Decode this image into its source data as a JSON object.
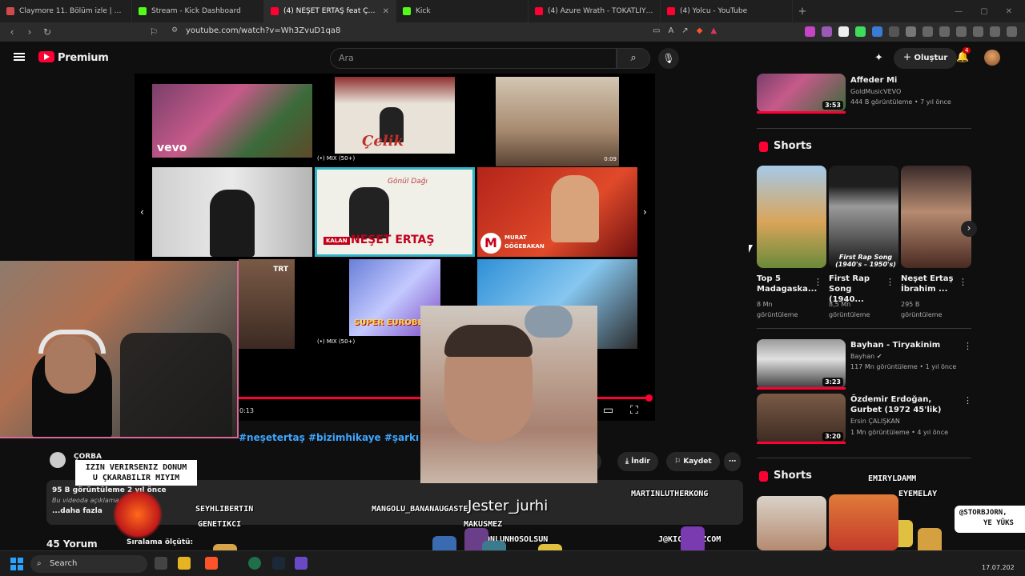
{
  "tabs": [
    {
      "label": "Claymore 11. Bölüm izle | Anizm",
      "color": "#d04a4a"
    },
    {
      "label": "Stream - Kick Dashboard",
      "color": "#53fc18"
    },
    {
      "label": "(4) NEŞET ERTAŞ feat ÇAĞATAY AK",
      "color": "#ff0033"
    },
    {
      "label": "Kick",
      "color": "#53fc18"
    },
    {
      "label": "(4) Azure Wrath - TOKATLIYIM (Prod.",
      "color": "#ff0033"
    },
    {
      "label": "(4) Yolcu - YouTube",
      "color": "#ff0033"
    }
  ],
  "address": {
    "url": "youtube.com/watch?v=Wh3ZvuD1qa8"
  },
  "header": {
    "brand": "Premium",
    "search_placeholder": "Ara",
    "create_label": "Oluştur",
    "notif_count": "4"
  },
  "player": {
    "mix_label_1": "(•) MIX (50+)",
    "mix_label_2": "(•) MIX (50+)",
    "tile_time": "0:09",
    "tile_text_vevo": "vevo",
    "tile_text_celik": "Çelik",
    "tile_text_gonul": "Gönül Dağı",
    "tile_text_kalan": "KALAN",
    "tile_text_neset": "NEŞET ERTAŞ",
    "tile_text_murat": "MURAT",
    "tile_text_gogebakan": "GÖĞEBAKAN",
    "tile_text_trt": "TRT",
    "tile_text_super": "SUPER EUROBEAT",
    "time": "0:13",
    "progress": 1.0
  },
  "video": {
    "hashtags": "#neşetertaş #bizimhikaye #şarkı #kome",
    "channel": "ÇORBA",
    "download_label": "İndir",
    "save_label": "Kaydet",
    "share_label": "aş",
    "views": "95 B görüntüleme  2 yıl önce",
    "desc": "Bu videoda açıklama mevcut d",
    "more": "...daha fazla",
    "comments": "45 Yorum",
    "sort": "Sıralama ölçütü:"
  },
  "overlays": {
    "banner_line1": "IZIN VERIRSENIZ DONUM",
    "banner_line2": "U ÇKARABILIR MIYIM",
    "names": {
      "seyhlibertin": "SEYHLIBERTIN",
      "genetikci": "GENETIKCI",
      "mangolu": "MANGOLU_BANANAUGASTE",
      "martin": "MARTINLUTHERKONG",
      "makusmez": "MAKUSMEZ",
      "gonlun": "GONLUNHOSOLSUN",
      "kick": "J@KICKLOGZCOM",
      "emiry": "EMIRYLDAMM",
      "eyemelay": "EYEMELAY",
      "storb": "@STORBJORN,",
      "yeyuks": "YE YÜKS"
    },
    "big_name": "Jester_jurhi"
  },
  "sidebar": {
    "top_video": {
      "title": "Affeder Mi",
      "channel": "GoldMusicVEVO",
      "meta": "444 B görüntüleme • 7 yıl önce",
      "duration": "3:53"
    },
    "shorts_label": "Shorts",
    "shorts": [
      {
        "title": "Top 5 Madagaska...",
        "views": "8 Mn",
        "views2": "görüntüleme"
      },
      {
        "title": "First Rap Song (1940...",
        "views": "8,5 Mn",
        "views2": "görüntüleme",
        "overlay": "First Rap Song (1940's – 1950's)"
      },
      {
        "title": "Neşet Ertaş İbrahim ...",
        "views": "295 B",
        "views2": "görüntüleme"
      }
    ],
    "videos": [
      {
        "title": "Bayhan - Tiryakinim",
        "channel": "Bayhan ✔",
        "meta": "117 Mn görüntüleme • 1 yıl önce",
        "duration": "3:23"
      },
      {
        "title": "Özdemir Erdoğan, Gurbet (1972 45'lik)",
        "channel": "Ersin ÇALIŞKAN",
        "meta": "1 Mn görüntüleme • 4 yıl önce",
        "duration": "3:20"
      }
    ],
    "shorts_label_2": "Shorts"
  },
  "taskbar": {
    "search_label": "Search",
    "date": "17.07.202"
  }
}
